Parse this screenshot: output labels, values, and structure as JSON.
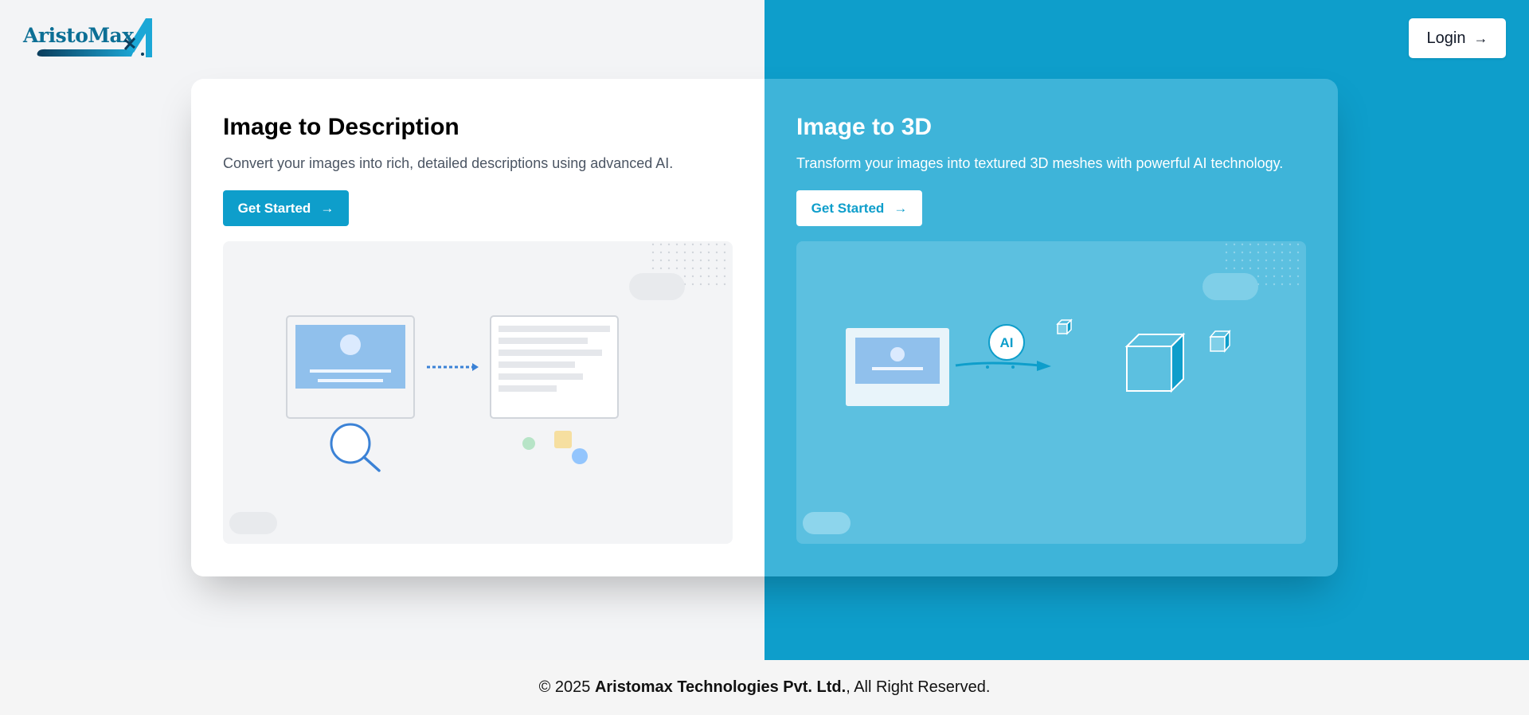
{
  "brand": {
    "logo_text": "AristoMax"
  },
  "header": {
    "login_label": "Login",
    "login_icon": "arrow-right-icon"
  },
  "cards": [
    {
      "title": "Image to Description",
      "description": "Convert your images into rich, detailed descriptions using advanced AI.",
      "button_label": "Get Started",
      "button_icon": "arrow-right-icon"
    },
    {
      "title": "Image to 3D",
      "description": "Transform your images into textured 3D meshes with powerful AI technology.",
      "button_label": "Get Started",
      "button_icon": "arrow-right-icon",
      "ai_badge": "AI"
    }
  ],
  "footer": {
    "prefix": "© 2025 ",
    "company": "Aristomax Technologies Pvt. Ltd.",
    "suffix": ", All Right Reserved."
  },
  "colors": {
    "accent": "#0e9ecb",
    "right_panel": "#3eb4d9",
    "page_bg": "#f3f4f6"
  }
}
